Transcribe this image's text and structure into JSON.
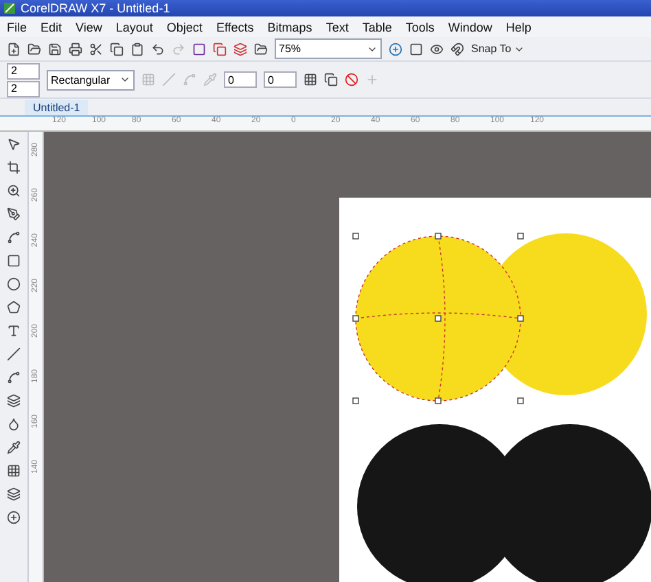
{
  "window": {
    "title": "CorelDRAW X7 - Untitled-1"
  },
  "menu": [
    "File",
    "Edit",
    "View",
    "Layout",
    "Object",
    "Effects",
    "Bitmaps",
    "Text",
    "Table",
    "Tools",
    "Window",
    "Help"
  ],
  "toolbar": {
    "zoom": "75%",
    "snap": "Snap To"
  },
  "property_bar": {
    "rows": "2",
    "columns": "2",
    "corner_type": "Rectangular",
    "value_1": "0",
    "value_2": "0"
  },
  "document_tabs": [
    {
      "label": "Untitled-1",
      "selected": true
    }
  ],
  "horizontal_ruler": [
    "120",
    "100",
    "80",
    "60",
    "40",
    "20",
    "0",
    "20",
    "40",
    "60",
    "80",
    "100",
    "120"
  ],
  "vertical_ruler": [
    "280",
    "260",
    "240",
    "220",
    "200",
    "180",
    "160",
    "140"
  ],
  "shapes": [
    {
      "color": "#f7dc1d",
      "selected": true
    },
    {
      "color": "#f7dc1d",
      "selected": false
    },
    {
      "color": "#161616",
      "selected": false
    },
    {
      "color": "#161616",
      "selected": false
    }
  ]
}
